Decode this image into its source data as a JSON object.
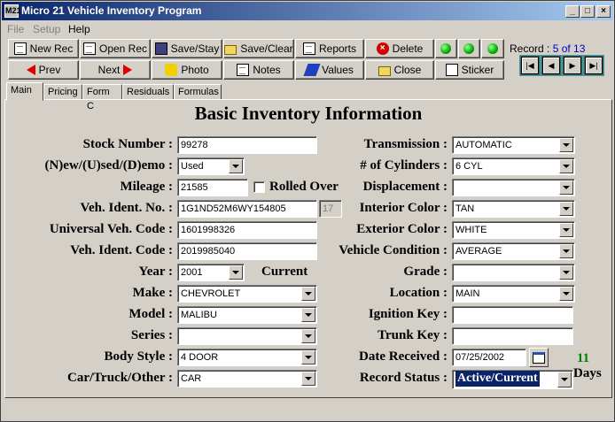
{
  "window": {
    "title": "Micro 21 Vehicle Inventory Program",
    "app_icon": "M21"
  },
  "menu": [
    "File",
    "Setup",
    "Help"
  ],
  "toolbar": {
    "new_rec": "New Rec",
    "open_rec": "Open Rec",
    "save_stay": "Save/Stay",
    "save_clear": "Save/Clear",
    "reports": "Reports",
    "delete": "Delete",
    "prev": "Prev",
    "next": "Next",
    "photo": "Photo",
    "notes": "Notes",
    "values": "Values",
    "close": "Close",
    "sticker": "Sticker"
  },
  "record": {
    "label": "Record :",
    "value": "5 of 13"
  },
  "tabs": [
    "Main",
    "Pricing",
    "Form C",
    "Residuals",
    "Formulas"
  ],
  "heading": "Basic Inventory Information",
  "left": {
    "stock_number": {
      "label": "Stock Number :",
      "value": "99278"
    },
    "new_used": {
      "label": "(N)ew/(U)sed/(D)emo :",
      "value": "Used"
    },
    "mileage": {
      "label": "Mileage :",
      "value": "21585",
      "rolled_over": "Rolled Over"
    },
    "vin": {
      "label": "Veh. Ident. No. :",
      "value": "1G1ND52M6WY154805",
      "count": "17"
    },
    "universal_code": {
      "label": "Universal Veh. Code :",
      "value": "1601998326"
    },
    "ident_code": {
      "label": "Veh. Ident. Code :",
      "value": "2019985040"
    },
    "year": {
      "label": "Year :",
      "value": "2001",
      "current": "Current"
    },
    "make": {
      "label": "Make :",
      "value": "CHEVROLET"
    },
    "model": {
      "label": "Model :",
      "value": "MALIBU"
    },
    "series": {
      "label": "Series :",
      "value": ""
    },
    "body_style": {
      "label": "Body Style :",
      "value": "4 DOOR"
    },
    "car_truck": {
      "label": "Car/Truck/Other :",
      "value": "CAR"
    }
  },
  "right": {
    "transmission": {
      "label": "Transmission :",
      "value": "AUTOMATIC"
    },
    "cylinders": {
      "label": "# of Cylinders :",
      "value": "6 CYL"
    },
    "displacement": {
      "label": "Displacement :",
      "value": ""
    },
    "interior_color": {
      "label": "Interior Color :",
      "value": "TAN"
    },
    "exterior_color": {
      "label": "Exterior Color :",
      "value": "WHITE"
    },
    "condition": {
      "label": "Vehicle Condition :",
      "value": "AVERAGE"
    },
    "grade": {
      "label": "Grade :",
      "value": ""
    },
    "location": {
      "label": "Location :",
      "value": "MAIN"
    },
    "ignition_key": {
      "label": "Ignition Key :",
      "value": ""
    },
    "trunk_key": {
      "label": "Trunk Key :",
      "value": ""
    },
    "date_received": {
      "label": "Date Received :",
      "value": "07/25/2002"
    },
    "record_status": {
      "label": "Record Status :",
      "value": "Active/Current"
    }
  },
  "days": {
    "value": "11",
    "label": "Days"
  }
}
